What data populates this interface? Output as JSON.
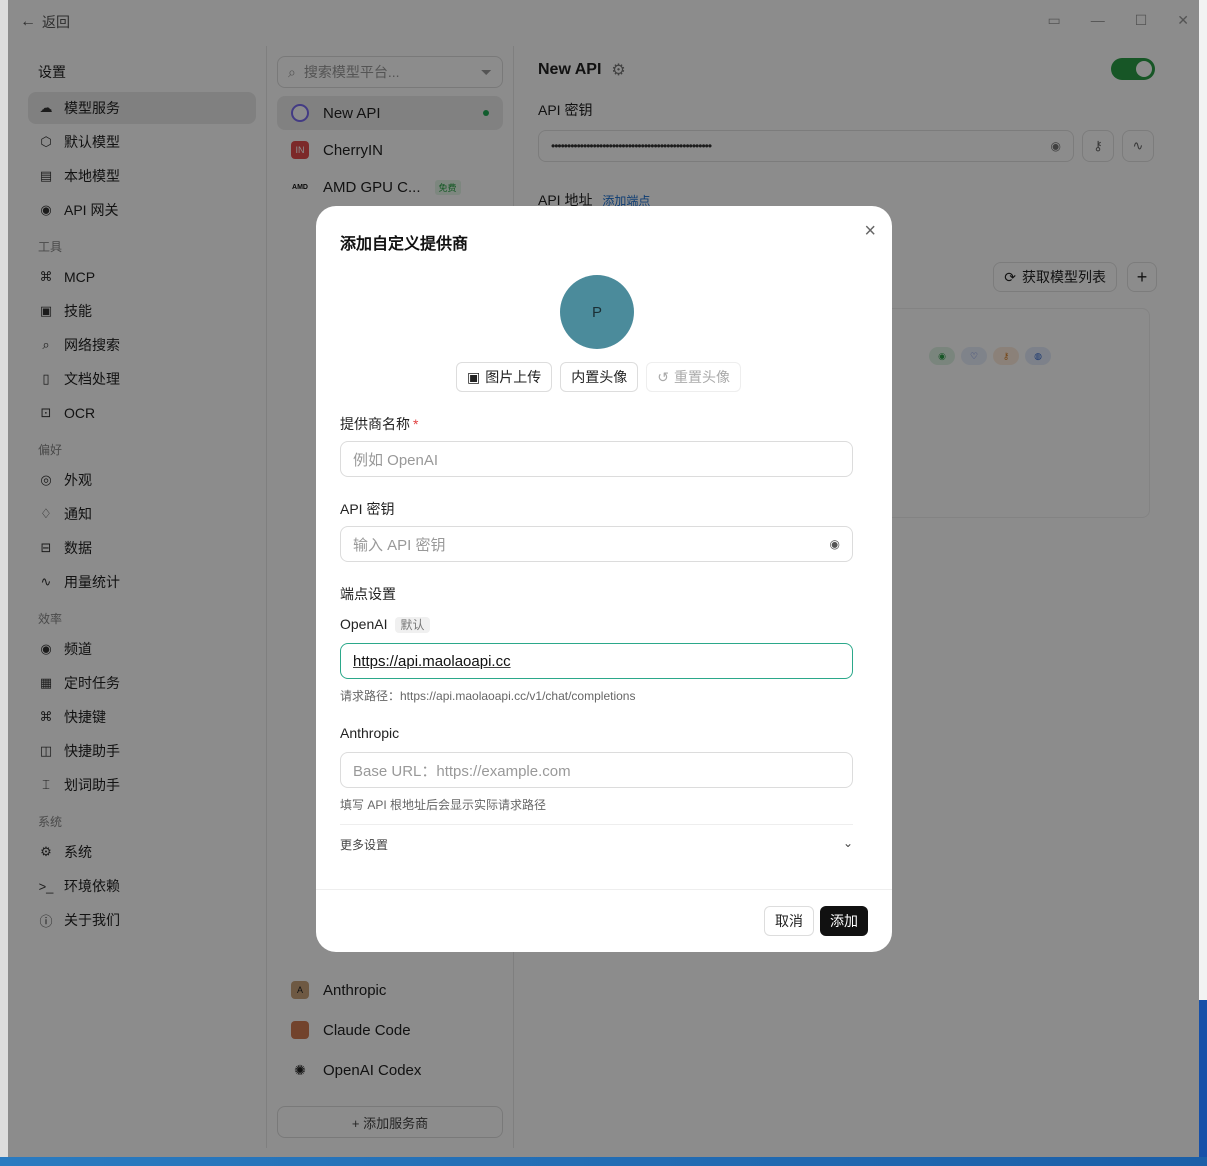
{
  "titlebar": {
    "back_label": "返回"
  },
  "sidebar": {
    "title": "设置",
    "items": [
      {
        "label": "模型服务",
        "icon": "cloud-icon"
      },
      {
        "label": "默认模型",
        "icon": "cube-icon"
      },
      {
        "label": "本地模型",
        "icon": "file-model-icon"
      },
      {
        "label": "API 网关",
        "icon": "antenna-icon"
      }
    ],
    "groups": [
      {
        "title": "工具",
        "items": [
          {
            "label": "MCP"
          },
          {
            "label": "技能"
          },
          {
            "label": "网络搜索"
          },
          {
            "label": "文档处理"
          },
          {
            "label": "OCR"
          }
        ]
      },
      {
        "title": "偏好",
        "items": [
          {
            "label": "外观"
          },
          {
            "label": "通知"
          },
          {
            "label": "数据"
          },
          {
            "label": "用量统计"
          }
        ]
      },
      {
        "title": "效率",
        "items": [
          {
            "label": "频道"
          },
          {
            "label": "定时任务"
          },
          {
            "label": "快捷键"
          },
          {
            "label": "快捷助手"
          },
          {
            "label": "划词助手"
          }
        ]
      },
      {
        "title": "系统",
        "items": [
          {
            "label": "系统"
          },
          {
            "label": "环境依赖"
          },
          {
            "label": "关于我们"
          }
        ]
      }
    ]
  },
  "providers": {
    "search_placeholder": "搜索模型平台...",
    "items": [
      {
        "label": "New API"
      },
      {
        "label": "CherryIN"
      },
      {
        "label": "AMD GPU C...",
        "badge": "免费"
      }
    ],
    "bottom_items": [
      {
        "label": "Anthropic"
      },
      {
        "label": "Claude Code"
      },
      {
        "label": "OpenAI Codex"
      }
    ],
    "add_label": "+ 添加服务商"
  },
  "main": {
    "title": "New API",
    "api_key_label": "API 密钥",
    "api_key_value": "••••••••••••••••••••••••••••••••••••••••••••••••••",
    "api_url_label": "API 地址",
    "add_endpoint_link": "添加端点",
    "fetch_models_label": "获取模型列表",
    "plus_label": "+"
  },
  "modal": {
    "title": "添加自定义提供商",
    "avatar_letter": "P",
    "upload_image_label": "图片上传",
    "builtin_avatar_label": "内置头像",
    "reset_avatar_label": "重置头像",
    "name_label": "提供商名称",
    "name_required": "*",
    "name_placeholder": "例如 OpenAI",
    "key_label": "API 密钥",
    "key_placeholder": "输入 API 密钥",
    "endpoint_section": "端点设置",
    "openai_label": "OpenAI",
    "openai_default_badge": "默认",
    "openai_value": "https://api.maolaoapi.cc",
    "openai_hint": "请求路径：https://api.maolaoapi.cc/v1/chat/completions",
    "anthropic_label": "Anthropic",
    "anthropic_placeholder": "Base URL：https://example.com",
    "anthropic_hint": "填写 API 根地址后会显示实际请求路径",
    "more_settings": "更多设置",
    "cancel_label": "取消",
    "add_label": "添加"
  }
}
